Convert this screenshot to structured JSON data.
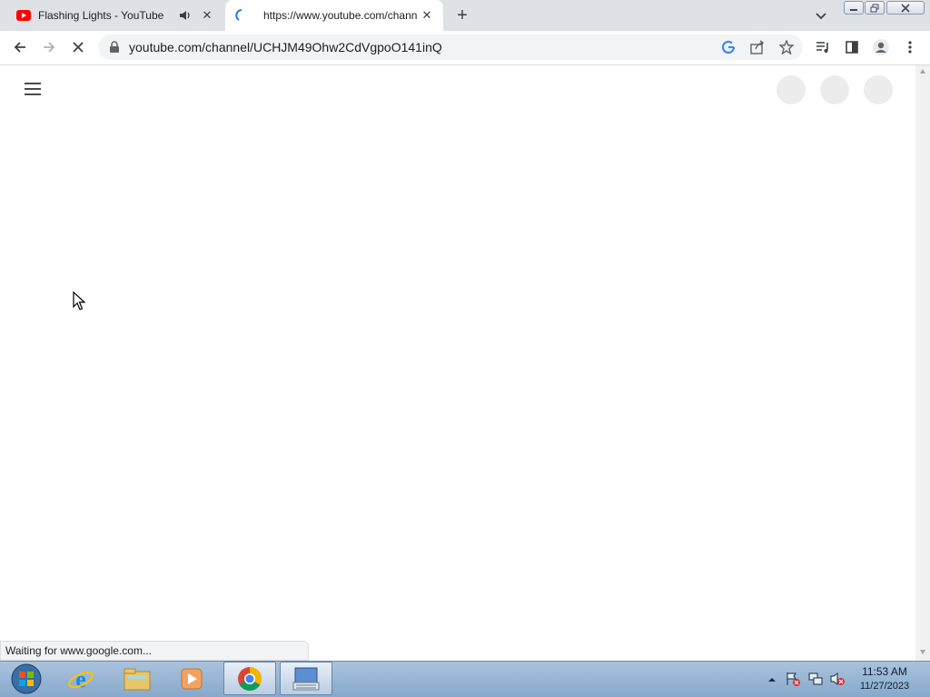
{
  "tabs": [
    {
      "title": "Flashing Lights - YouTube",
      "favicon": "youtube-icon",
      "audio": "speaker-icon"
    },
    {
      "title": "https://www.youtube.com/chann",
      "favicon": "loading-spinner-icon"
    }
  ],
  "new_tab_label": "+",
  "address_bar": {
    "url": "youtube.com/channel/UCHJM49Ohw2CdVgpoO141inQ"
  },
  "status_bar": {
    "text": "Waiting for www.google.com..."
  },
  "taskbar": {
    "items": [
      "start-orb-icon",
      "internet-explorer-icon",
      "file-explorer-icon",
      "media-player-icon",
      "chrome-icon",
      "on-screen-keyboard-icon"
    ],
    "clock": {
      "time": "11:53 AM",
      "date": "11/27/2023"
    }
  },
  "colors": {
    "youtube_red": "#ff0000",
    "tab_strip": "#dee1e6",
    "taskbar": "#9db8d6"
  }
}
